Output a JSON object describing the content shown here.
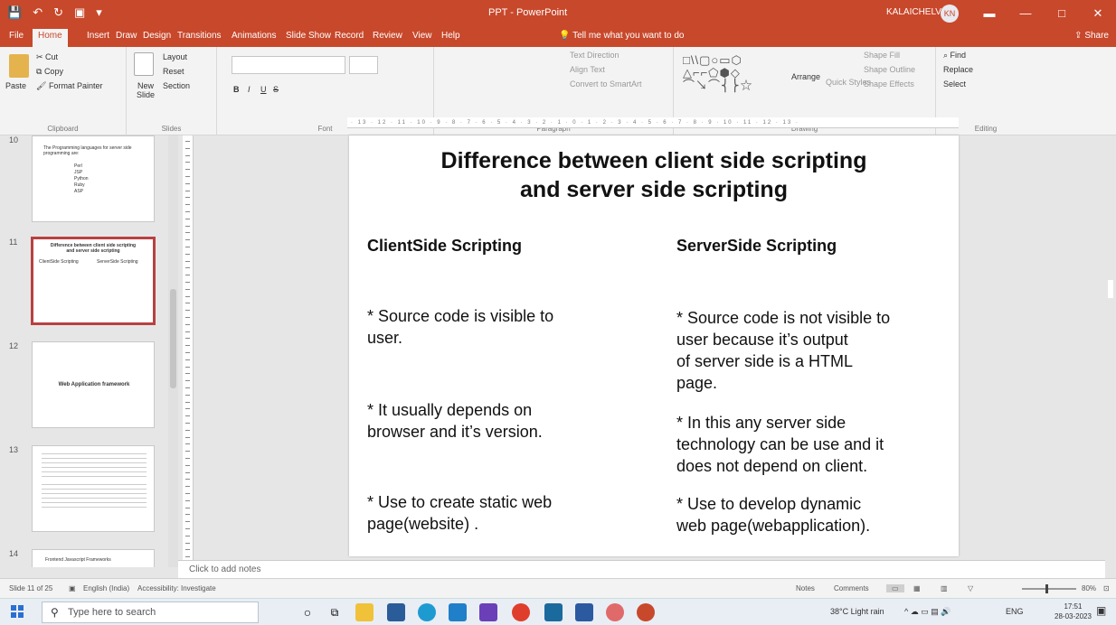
{
  "titlebar": {
    "title": "PPT - PowerPoint",
    "user": "KALAICHELVI N",
    "avatar_initials": "KN",
    "quick_access": [
      "💾",
      "↶",
      "↻",
      "▣",
      "▾"
    ],
    "window_buttons": [
      "▬",
      "—",
      "□",
      "✕"
    ]
  },
  "menu": {
    "tabs": [
      "File",
      "Home",
      "Insert",
      "Draw",
      "Design",
      "Transitions",
      "Animations",
      "Slide Show",
      "Record",
      "Review",
      "View",
      "Help"
    ],
    "tell_me": "Tell me what you want to do",
    "share": "Share"
  },
  "ribbon": {
    "clipboard": {
      "paste": "Paste",
      "cut": "Cut",
      "copy": "Copy",
      "format_painter": "Format Painter",
      "label": "Clipboard"
    },
    "slides": {
      "new_slide": "New Slide",
      "layout": "Layout",
      "reset": "Reset",
      "section": "Section",
      "label": "Slides"
    },
    "font": {
      "bold": "B",
      "italic": "I",
      "underline": "U",
      "strike": "S",
      "label": "Font"
    },
    "paragraph": {
      "text_direction": "Text Direction",
      "align_text": "Align Text",
      "smartart": "Convert to SmartArt",
      "label": "Paragraph"
    },
    "drawing": {
      "shapes": "□\\\\▢○▭⬡\n△⌐⌐⬠⬢◇\n⌒↘⌒⎨⎬☆",
      "arrange": "Arrange",
      "quick_styles": "Quick Styles",
      "shape_fill": "Shape Fill",
      "shape_outline": "Shape Outline",
      "shape_effects": "Shape Effects",
      "label": "Drawing"
    },
    "editing": {
      "find": "Find",
      "replace": "Replace",
      "select": "Select",
      "label": "Editing"
    }
  },
  "thumbnails": [
    {
      "number": "10",
      "title": "The Programming languages for server side programming are:",
      "items": [
        "Perl",
        "JSP",
        "Python",
        "Ruby",
        "ASP"
      ]
    },
    {
      "number": "11",
      "title": "Difference between client side scripting and server side scripting",
      "selected": true
    },
    {
      "number": "12",
      "title": "Web Application framework"
    },
    {
      "number": "13",
      "title": ""
    },
    {
      "number": "14",
      "title": "Frontend Javascript Frameworks"
    }
  ],
  "slide": {
    "title_line1": "Difference between client side scripting",
    "title_line2": "and server side scripting",
    "left_heading": "ClientSide Scripting",
    "right_heading": "ServerSide Scripting",
    "left_bullets": [
      "* Source code is visible to\nuser.",
      "* It usually depends on\nbrowser and it’s version.",
      "* Use to create static web\npage(website) ."
    ],
    "right_bullets": [
      "* Source code is not visible to\nuser because it’s output\nof server side is a HTML\npage.",
      "* In this any server side\ntechnology can be use and it\ndoes not depend on client.",
      "* Use to develop dynamic\nweb page(webapplication)."
    ]
  },
  "notes": {
    "placeholder": "Click to add notes"
  },
  "status": {
    "slide_count": "Slide 11 of 25",
    "language": "English (India)",
    "accessibility": "Accessibility: Investigate",
    "notes_btn": "Notes",
    "comments_btn": "Comments",
    "zoom": "80%"
  },
  "taskbar": {
    "search_placeholder": "Type here to search",
    "weather": "38°C Light rain",
    "lang": "ENG",
    "time": "17:51",
    "date": "28-03-2023"
  },
  "colors": {
    "accent": "#c8482b",
    "selected_thumb_border": "#b84141"
  }
}
